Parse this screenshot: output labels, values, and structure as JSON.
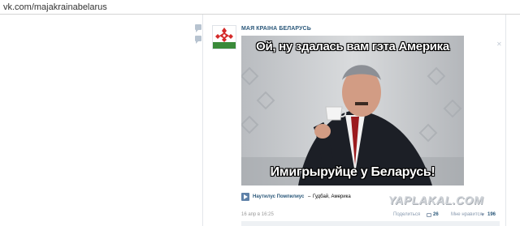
{
  "browser": {
    "url": "vk.com/majakrainabelarus"
  },
  "post": {
    "group_name": "МАЯ КРАІНА БЕЛАРУСЬ",
    "image": {
      "caption_top": "Ой, ну здалась вам гэта Америка",
      "caption_bottom": "Имигрыруйце у Беларусь!"
    },
    "audio": {
      "artist": "Наутилус Помпилиус",
      "separator": "–",
      "title": "Гудбай, Америка"
    },
    "date": "16 апр в 16:25",
    "actions": {
      "share_label": "Поделиться",
      "share_count": "26",
      "like_label": "Мне нравится",
      "like_count": "196"
    }
  },
  "watermark": "YAPLAKAL.COM",
  "colors": {
    "link": "#2b587a",
    "muted": "#999999",
    "icon": "#8a9bb0"
  }
}
